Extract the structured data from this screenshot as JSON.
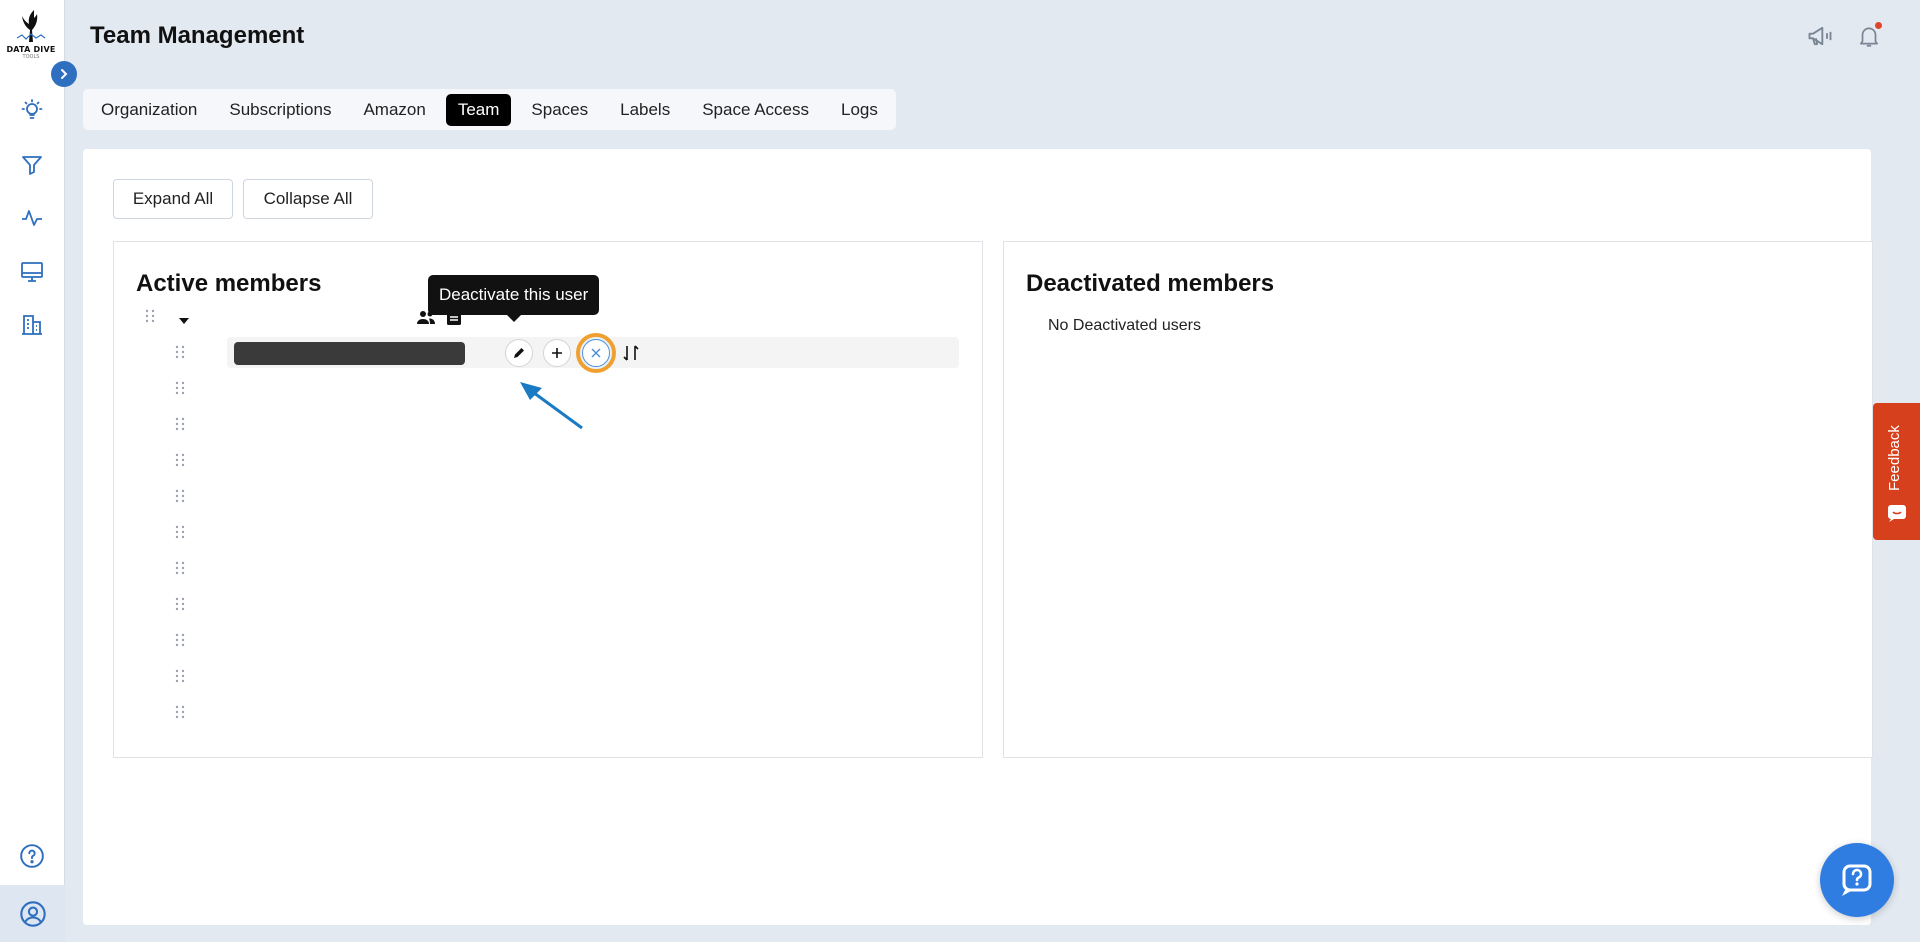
{
  "page": {
    "title": "Team Management"
  },
  "logo": {
    "brand": "DATA DIVE",
    "sub": "TOOLS"
  },
  "sidebar": {
    "items": [
      {
        "name": "lightbulb-icon"
      },
      {
        "name": "filter-icon"
      },
      {
        "name": "activity-icon"
      },
      {
        "name": "monitor-icon"
      },
      {
        "name": "building-icon"
      },
      {
        "name": "help-circle-icon"
      },
      {
        "name": "account-icon"
      }
    ]
  },
  "tabs": [
    {
      "label": "Organization",
      "active": false
    },
    {
      "label": "Subscriptions",
      "active": false
    },
    {
      "label": "Amazon",
      "active": false
    },
    {
      "label": "Team",
      "active": true
    },
    {
      "label": "Spaces",
      "active": false
    },
    {
      "label": "Labels",
      "active": false
    },
    {
      "label": "Space Access",
      "active": false
    },
    {
      "label": "Logs",
      "active": false
    }
  ],
  "toolbar": {
    "expand_label": "Expand All",
    "collapse_label": "Collapse All"
  },
  "active_panel": {
    "title": "Active members",
    "tooltip": "Deactivate this user"
  },
  "deactivated_panel": {
    "title": "Deactivated members",
    "empty_text": "No Deactivated users"
  },
  "feedback": {
    "label": "Feedback"
  },
  "colors": {
    "accent": "#2f6fbf",
    "highlight": "#f0a030",
    "feedback": "#d6401c",
    "help": "#2f7de1"
  }
}
